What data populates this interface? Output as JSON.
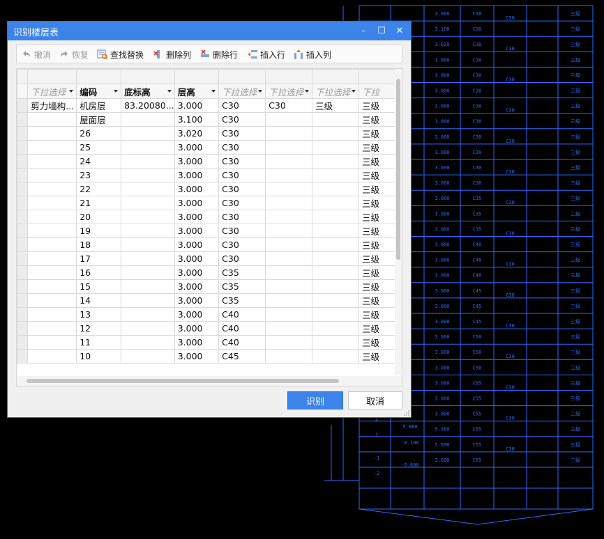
{
  "dialog": {
    "title": "识别楼层表",
    "controls": [
      "–",
      "☐",
      "✕"
    ]
  },
  "toolbar": {
    "undo": "撤消",
    "redo": "恢复",
    "find_replace": "查找替换",
    "delete_column": "删除列",
    "delete_row": "删除行",
    "insert_row": "插入行",
    "insert_column": "插入列"
  },
  "grid": {
    "headers": [
      "下拉选择",
      "编码",
      "底标高",
      "层高",
      "下拉选择",
      "下拉选择",
      "下拉选择",
      "下拉"
    ],
    "placeholder_cols": [
      0,
      4,
      5,
      6,
      7
    ],
    "rows": [
      [
        "剪力墙构...",
        "机房层",
        "83.20080...",
        "3.000",
        "C30",
        "C30",
        "三级",
        "三级"
      ],
      [
        "",
        "屋面层",
        "",
        "3.100",
        "C30",
        "",
        "",
        "三级"
      ],
      [
        "",
        "26",
        "",
        "3.020",
        "C30",
        "",
        "",
        "三级"
      ],
      [
        "",
        "25",
        "",
        "3.000",
        "C30",
        "",
        "",
        "三级"
      ],
      [
        "",
        "24",
        "",
        "3.000",
        "C30",
        "",
        "",
        "三级"
      ],
      [
        "",
        "23",
        "",
        "3.000",
        "C30",
        "",
        "",
        "三级"
      ],
      [
        "",
        "22",
        "",
        "3.000",
        "C30",
        "",
        "",
        "三级"
      ],
      [
        "",
        "21",
        "",
        "3.000",
        "C30",
        "",
        "",
        "三级"
      ],
      [
        "",
        "20",
        "",
        "3.000",
        "C30",
        "",
        "",
        "三级"
      ],
      [
        "",
        "19",
        "",
        "3.000",
        "C30",
        "",
        "",
        "三级"
      ],
      [
        "",
        "18",
        "",
        "3.000",
        "C30",
        "",
        "",
        "三级"
      ],
      [
        "",
        "17",
        "",
        "3.000",
        "C30",
        "",
        "",
        "三级"
      ],
      [
        "",
        "16",
        "",
        "3.000",
        "C35",
        "",
        "",
        "三级"
      ],
      [
        "",
        "15",
        "",
        "3.000",
        "C35",
        "",
        "",
        "三级"
      ],
      [
        "",
        "14",
        "",
        "3.000",
        "C35",
        "",
        "",
        "三级"
      ],
      [
        "",
        "13",
        "",
        "3.000",
        "C40",
        "",
        "",
        "三级"
      ],
      [
        "",
        "12",
        "",
        "3.000",
        "C40",
        "",
        "",
        "三级"
      ],
      [
        "",
        "11",
        "",
        "3.000",
        "C40",
        "",
        "",
        "三级"
      ],
      [
        "",
        "10",
        "",
        "3.000",
        "C45",
        "",
        "",
        "三级"
      ]
    ]
  },
  "buttons": {
    "ok": "识别",
    "cancel": "取消"
  },
  "cad": {
    "line_color": "#2a6cff",
    "rows": [
      [
        "3.000",
        "C30"
      ],
      [
        "3.100",
        "C30"
      ],
      [
        "3.020",
        "C30"
      ],
      [
        "3.000",
        "C30"
      ],
      [
        "3.000",
        "C30"
      ],
      [
        "3.000",
        "C30"
      ],
      [
        "3.000",
        "C30"
      ],
      [
        "3.000",
        "C30"
      ],
      [
        "3.000",
        "C30"
      ],
      [
        "3.000",
        "C30"
      ],
      [
        "3.000",
        "C30"
      ],
      [
        "3.000",
        "C30"
      ],
      [
        "3.000",
        "C35"
      ],
      [
        "3.000",
        "C35"
      ],
      [
        "3.000",
        "C35"
      ],
      [
        "3.000",
        "C40"
      ],
      [
        "3.000",
        "C40"
      ],
      [
        "3.000",
        "C40"
      ],
      [
        "3.000",
        "C45"
      ],
      [
        "3.000",
        "C45"
      ],
      [
        "3.000",
        "C45"
      ],
      [
        "3.000",
        "C50"
      ],
      [
        "3.000",
        "C50"
      ],
      [
        "3.000",
        "C50"
      ],
      [
        "3.000",
        "C55"
      ],
      [
        "3.000",
        "C55"
      ],
      [
        "3.000",
        "C55"
      ],
      [
        "5.380",
        "C55"
      ],
      [
        "5.500",
        "C55"
      ],
      [
        "3.600",
        "C55"
      ]
    ],
    "elevation_labels": [
      "5.880",
      "-0.100",
      "-5.600"
    ],
    "floor_labels": [
      "2",
      "1",
      "-1",
      "-2"
    ],
    "right_grade": "三级",
    "mid_grade": "C30"
  }
}
